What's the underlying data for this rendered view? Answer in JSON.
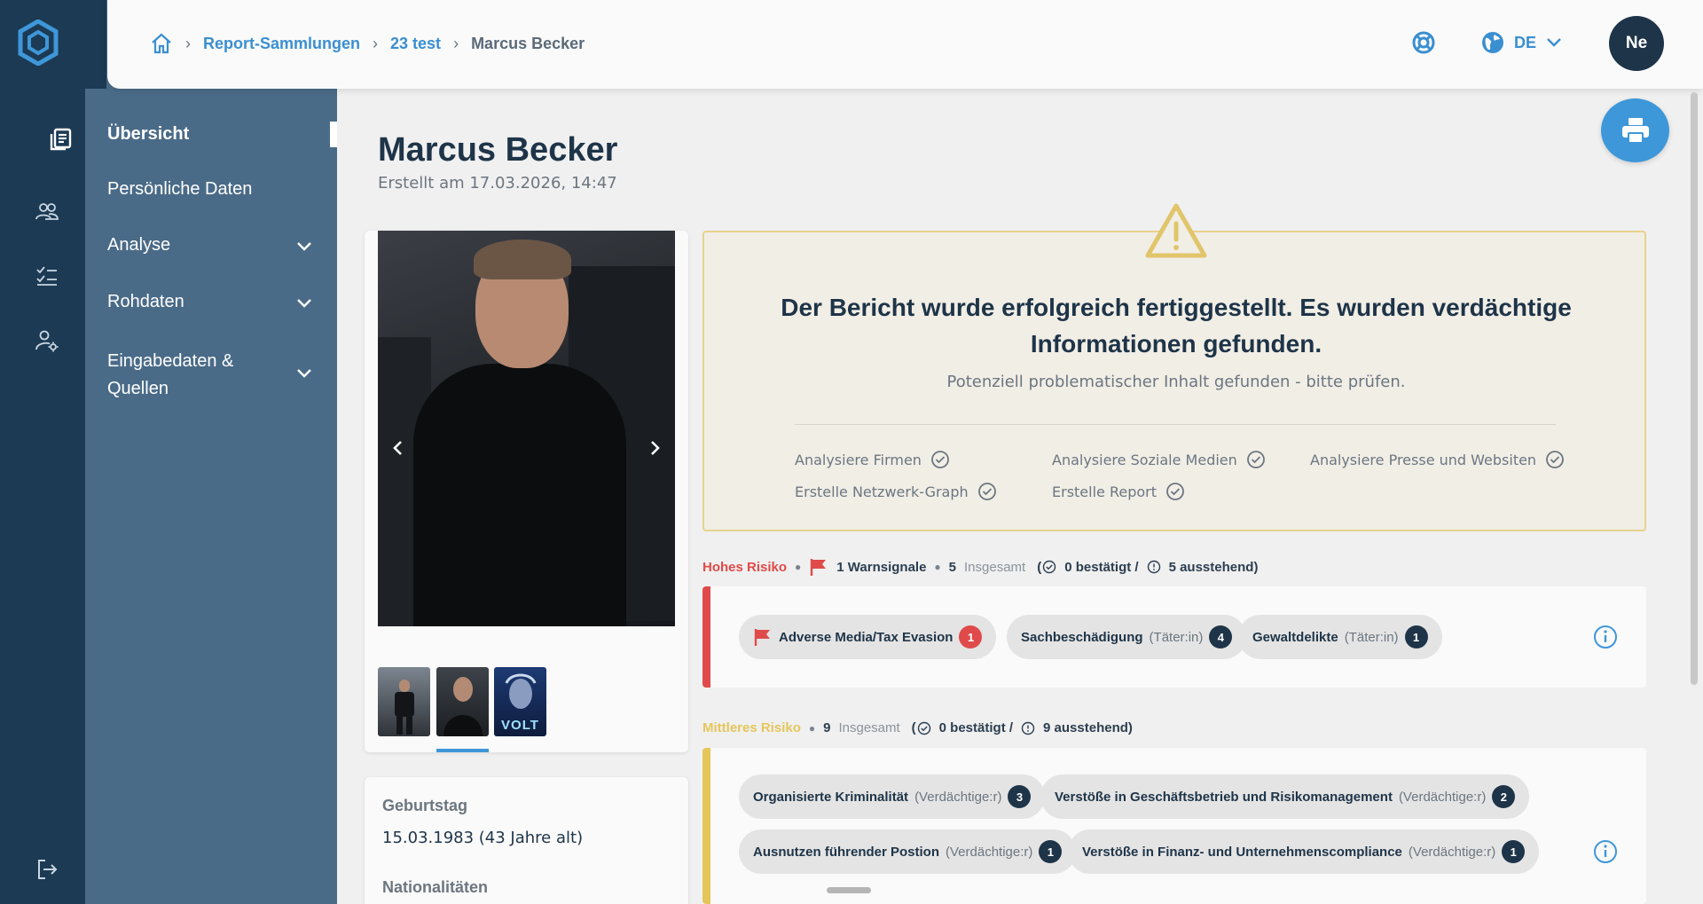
{
  "colors": {
    "rail": "#1c3a54",
    "sidebar": "#4a6b88",
    "accent": "#3e97d8",
    "high_risk": "#e04a4a",
    "medium_risk": "#e6c55a",
    "navy": "#1e3448"
  },
  "rail": {
    "icons": [
      "logo-icon",
      "report-icon",
      "users-icon",
      "checklist-icon",
      "user-settings-icon",
      "logout-icon"
    ]
  },
  "sidebar": {
    "items": [
      {
        "label": "Übersicht"
      },
      {
        "label": "Persönliche Daten"
      },
      {
        "label": "Analyse"
      },
      {
        "label": "Rohdaten"
      },
      {
        "label": "Eingabedaten & Quellen"
      }
    ]
  },
  "header": {
    "breadcrumb": [
      "Report-Sammlungen",
      "23 test",
      "Marcus Becker"
    ],
    "language": "DE",
    "avatar_initials": "Ne"
  },
  "profile": {
    "name": "Marcus Becker",
    "created": "Erstellt am 17.03.2026, 14:47",
    "birthday_label": "Geburtstag",
    "birthday_value": "15.03.1983 (43 Jahre alt)",
    "nationality_label": "Nationalitäten",
    "thumbnail_badge": "VOLT"
  },
  "alert": {
    "title": "Der Bericht wurde erfolgreich fertiggestellt. Es wurden verdächtige Informationen gefunden.",
    "subtitle": "Potenziell problematischer Inhalt gefunden - bitte prüfen.",
    "steps": [
      "Analysiere Firmen",
      "Analysiere Soziale Medien",
      "Analysiere Presse und Websiten",
      "Erstelle Netzwerk-Graph",
      "Erstelle Report"
    ]
  },
  "high_risk": {
    "level": "Hohes Risiko",
    "warnings": "1 Warnsignale",
    "total_count": "5",
    "total_label": "Insgesamt",
    "confirmed": "0 bestätigt /",
    "pending": "5 ausstehend)",
    "chips": [
      {
        "name": "Adverse Media/Tax Evasion",
        "role": "",
        "count": "1"
      },
      {
        "name": "Sachbeschädigung",
        "role": "(Täter:in)",
        "count": "4"
      },
      {
        "name": "Gewaltdelikte",
        "role": "(Täter:in)",
        "count": "1"
      }
    ]
  },
  "medium_risk": {
    "level": "Mittleres Risiko",
    "total_count": "9",
    "total_label": "Insgesamt",
    "confirmed": "0 bestätigt /",
    "pending": "9 ausstehend)",
    "chips": [
      {
        "name": "Organisierte Kriminalität",
        "role": "(Verdächtige:r)",
        "count": "3"
      },
      {
        "name": "Verstöße in Geschäftsbetrieb und Risikomanagement",
        "role": "(Verdächtige:r)",
        "count": "2"
      },
      {
        "name": "Ausnutzen führender Postion",
        "role": "(Verdächtige:r)",
        "count": "1"
      },
      {
        "name": "Verstöße in Finanz- und Unternehmenscompliance",
        "role": "(Verdächtige:r)",
        "count": "1"
      }
    ]
  }
}
